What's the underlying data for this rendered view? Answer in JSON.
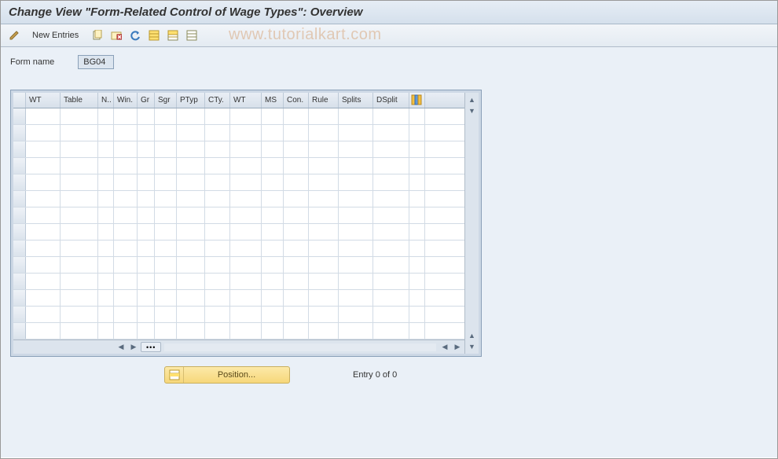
{
  "title": "Change View \"Form-Related Control of Wage Types\": Overview",
  "toolbar": {
    "new_entries": "New Entries",
    "icons": {
      "toggle": "toggle-change-icon",
      "copy": "copy-icon",
      "delete": "delete-icon",
      "undo": "undo-icon",
      "select_all": "select-all-icon",
      "select_block": "select-block-icon",
      "deselect": "deselect-all-icon"
    }
  },
  "watermark": "www.tutorialkart.com",
  "form": {
    "label": "Form name",
    "value": "BG04"
  },
  "table": {
    "columns": [
      "WT",
      "Table",
      "N..",
      "Win.",
      "Gr",
      "Sgr",
      "PTyp",
      "CTy.",
      "WT",
      "MS",
      "Con.",
      "Rule",
      "Splits",
      "DSplit"
    ],
    "row_count": 14,
    "configure_tooltip": "Configure"
  },
  "footer": {
    "position_label": "Position...",
    "entry_text": "Entry 0 of 0"
  }
}
